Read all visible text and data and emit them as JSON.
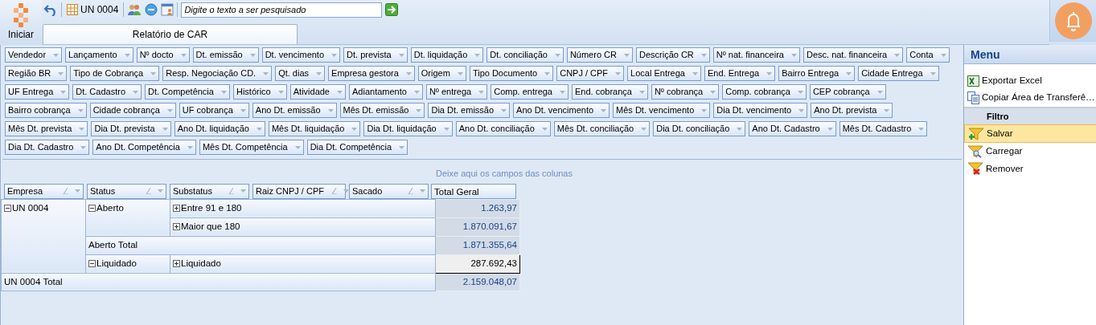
{
  "start_button": {
    "label": "Iniciar"
  },
  "toolbar": {
    "unit": "UN 0004",
    "search": {
      "placeholder": "Digite o texto a ser pesquisado"
    }
  },
  "tabs": [
    {
      "label": "Relatório de CAR",
      "selected": true
    }
  ],
  "filter_fields": [
    [
      "Vendedor",
      "Lançamento",
      "Nº docto",
      "Dt. emissão",
      "Dt. vencimento",
      "Dt. prevista",
      "Dt. liquidação",
      "Dt. conciliação",
      "Número CR",
      "Descrição CR",
      "Nº nat. financeira",
      "Desc. nat. financeira",
      "Conta"
    ],
    [
      "Região BR",
      "Tipo de Cobrança",
      "Resp. Negociação CD.",
      "Qt. dias",
      "Empresa gestora",
      "Origem",
      "Tipo Documento",
      "CNPJ / CPF",
      "Local Entrega",
      "End. Entrega",
      "Bairro Entrega",
      "Cidade Entrega"
    ],
    [
      "UF Entrega",
      "Dt. Cadastro",
      "Dt. Competência",
      "Histórico",
      "Atividade",
      "Adiantamento",
      "Nº entrega",
      "Comp. entrega",
      "End. cobrança",
      "Nº cobrança",
      "Comp. cobrança",
      "CEP cobrança"
    ],
    [
      "Bairro cobrança",
      "Cidade cobrança",
      "UF cobrança",
      "Ano Dt. emissão",
      "Mês Dt. emissão",
      "Dia Dt. emissão",
      "Ano Dt. vencimento",
      "Mês Dt. vencimento",
      "Dia Dt. vencimento",
      "Ano Dt. prevista"
    ],
    [
      "Mês Dt. prevista",
      "Dia Dt. prevista",
      "Ano Dt. liquidação",
      "Mês Dt. liquidação",
      "Dia Dt. liquidação",
      "Ano Dt. conciliação",
      "Mês Dt. conciliação",
      "Dia Dt. conciliação",
      "Ano Dt. Cadastro",
      "Mês Dt. Cadastro"
    ],
    [
      "Dia Dt. Cadastro",
      "Ano Dt. Competência",
      "Mês Dt. Competência",
      "Dia Dt. Competência"
    ]
  ],
  "pivot": {
    "column_drop_hint": "Deixe aqui os campos das colunas",
    "row_fields": [
      "Empresa",
      "Status",
      "Substatus",
      "Raiz CNPJ / CPF",
      "Sacado"
    ],
    "column_header": "Total Geral",
    "groups": [
      {
        "label": "UN 0004",
        "expanded": true,
        "total_label": "UN 0004 Total",
        "total": "2.159.048,07",
        "children": [
          {
            "label": "Aberto",
            "expanded": true,
            "total_label": "Aberto Total",
            "total": "1.871.355,64",
            "children": [
              {
                "label": "Entre 91 e 180",
                "expanded": false,
                "value": "1.263,97",
                "selected": false
              },
              {
                "label": "Maior que 180",
                "expanded": false,
                "value": "1.870.091,67",
                "selected": false
              }
            ]
          },
          {
            "label": "Liquidado",
            "expanded": true,
            "children": [
              {
                "label": "Liquidado",
                "expanded": false,
                "value": "287.692,43",
                "selected": true
              }
            ]
          }
        ]
      }
    ]
  },
  "menu": {
    "title": "Menu",
    "items": [
      {
        "kind": "excel",
        "label": "Exportar Excel"
      },
      {
        "kind": "copy",
        "label": "Copiar Área de Transferê…"
      }
    ],
    "section": "Filtro",
    "filter_items": [
      {
        "kind": "save",
        "label": "Salvar",
        "selected": true
      },
      {
        "kind": "load",
        "label": "Carregar",
        "selected": false
      },
      {
        "kind": "remove",
        "label": "Remover",
        "selected": false
      }
    ]
  }
}
